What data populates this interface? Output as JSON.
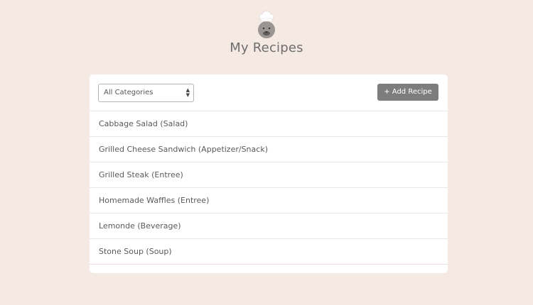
{
  "header": {
    "title": "My Recipes",
    "logo_icon": "chef-face-icon"
  },
  "toolbar": {
    "category_select": {
      "selected": "All Categories"
    },
    "add_button_label": "+ Add Recipe",
    "add_button_color": "#7d7d7d"
  },
  "recipes": [
    {
      "label": "Cabbage Salad (Salad)"
    },
    {
      "label": "Grilled Cheese Sandwich (Appetizer/Snack)"
    },
    {
      "label": "Grilled Steak (Entree)"
    },
    {
      "label": "Homemade Waffles (Entree)"
    },
    {
      "label": "Lemonde (Beverage)"
    },
    {
      "label": "Stone Soup (Soup)"
    }
  ],
  "colors": {
    "background": "#f5e9e4",
    "card": "#ffffff"
  }
}
